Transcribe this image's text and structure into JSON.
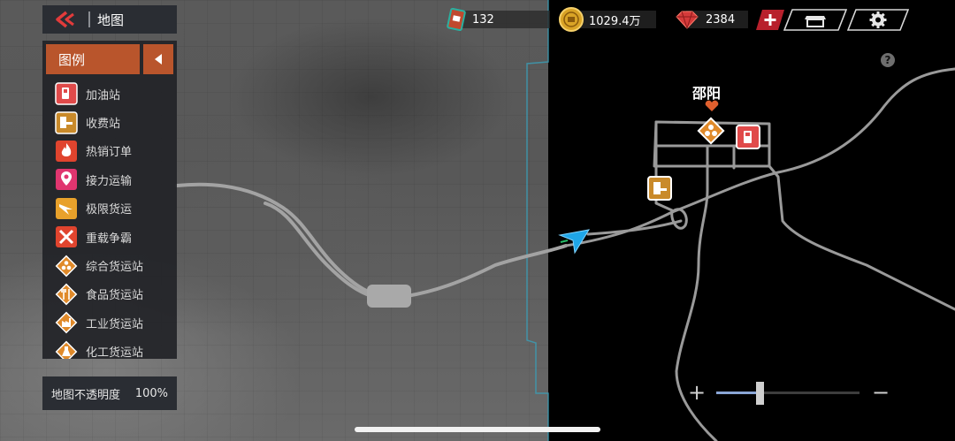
{
  "header": {
    "title": "地图"
  },
  "legend": {
    "title": "图例",
    "items": [
      {
        "label": "加油站",
        "icon": "fuel-icon",
        "color": "#e04a4a"
      },
      {
        "label": "收费站",
        "icon": "toll-icon",
        "color": "#c98a2a"
      },
      {
        "label": "热销订单",
        "icon": "fire-icon",
        "color": "#e0442e"
      },
      {
        "label": "接力运输",
        "icon": "relay-pin-icon",
        "color": "#e0356f"
      },
      {
        "label": "极限货运",
        "icon": "extreme-cargo-icon",
        "color": "#e8a12b"
      },
      {
        "label": "重载争霸",
        "icon": "heavy-battle-icon",
        "color": "#e0442e"
      },
      {
        "label": "综合货运站",
        "icon": "general-depot-icon",
        "color": "#e08a2a"
      },
      {
        "label": "食品货运站",
        "icon": "food-depot-icon",
        "color": "#e08a2a"
      },
      {
        "label": "工业货运站",
        "icon": "industry-depot-icon",
        "color": "#e08a2a"
      },
      {
        "label": "化工货运站",
        "icon": "chemical-depot-icon",
        "color": "#e08a2a"
      }
    ]
  },
  "opacity": {
    "label": "地图不透明度",
    "value": "100%"
  },
  "resources": {
    "cards": "132",
    "coins": "1029.4万",
    "gems": "2384"
  },
  "map": {
    "city": "邵阳",
    "help": "?",
    "zoom_level": 0.3
  },
  "colors": {
    "accent": "#b9552c",
    "panel": "#2a2d33",
    "road": "#9a9a9a",
    "player": "#1fa6e8"
  }
}
